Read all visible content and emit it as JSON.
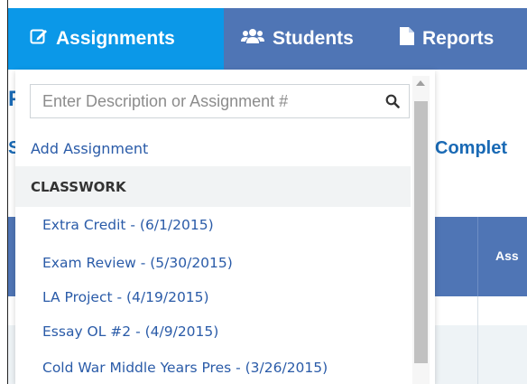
{
  "nav": {
    "tabs": [
      {
        "label": "Assignments",
        "icon": "edit-icon",
        "active": true
      },
      {
        "label": "Students",
        "icon": "users-icon",
        "active": false
      },
      {
        "label": "Reports",
        "icon": "document-icon",
        "active": false
      }
    ]
  },
  "background": {
    "heading_fragment": "P",
    "left_fragment": "S",
    "complete_fragment": "Complet",
    "column_header_fragment": "Ass"
  },
  "dropdown": {
    "search_placeholder": "Enter Description or Assignment #",
    "add_label": "Add Assignment",
    "section_label": "CLASSWORK",
    "items": [
      "Extra Credit - (6/1/2015)",
      "Exam Review - (5/30/2015)",
      "LA Project - (4/19/2015)",
      "Essay OL #2 - (4/9/2015)",
      "Cold War Middle Years Pres - (3/26/2015)"
    ]
  },
  "colors": {
    "nav_bg": "#4f75b5",
    "nav_active": "#0b98e8",
    "link": "#2a5ba8"
  }
}
